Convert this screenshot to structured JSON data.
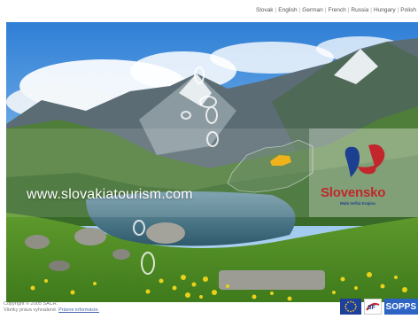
{
  "languages": [
    "Slovak",
    "English",
    "German",
    "French",
    "Russia",
    "Hungary",
    "Polish"
  ],
  "hero": {
    "site_url": "www.slovakiatourism.com",
    "brand_name": "Slovensko",
    "brand_slogan": "Malá Veľká Krajina"
  },
  "footer": {
    "copyright": "Copyright © 2005 SACR.",
    "rights": "Všetky práva vyhradené.",
    "legal_link": "Právne informácie."
  },
  "logos": {
    "sf_label": "SF",
    "sopsp_label": "SOPPS"
  },
  "colors": {
    "brand_red": "#c1272d",
    "brand_blue": "#1d3f8f",
    "eu_blue": "#1f3f9c",
    "map_highlight": "#f0b21a"
  }
}
